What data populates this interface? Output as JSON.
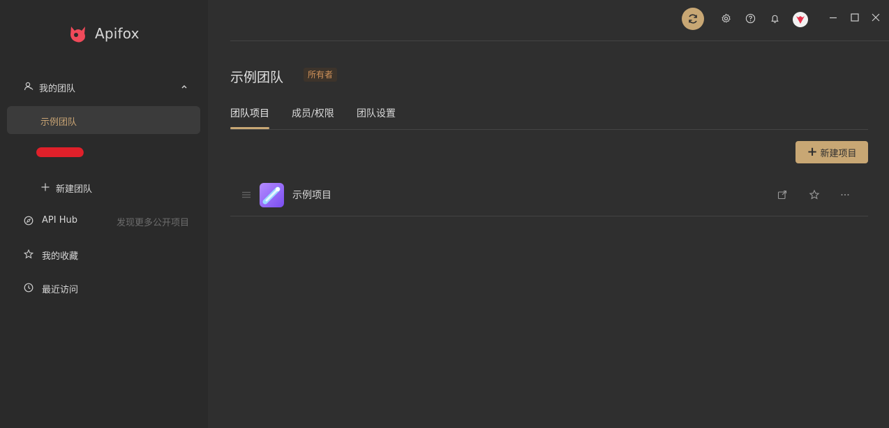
{
  "app": {
    "name": "Apifox"
  },
  "sidebar": {
    "my_team": "我的团队",
    "teams": [
      "示例团队"
    ],
    "new_team": "新建团队",
    "api_hub": "API Hub",
    "api_hub_hint": "发现更多公开项目",
    "favorites": "我的收藏",
    "recent": "最近访问"
  },
  "header": {
    "icons": [
      "sync-icon",
      "settings-icon",
      "help-icon",
      "bell-icon",
      "avatar",
      "minimize-icon",
      "maximize-icon",
      "close-icon"
    ]
  },
  "team": {
    "title": "示例团队",
    "role_badge": "所有者"
  },
  "tabs": [
    {
      "label": "团队项目",
      "active": true
    },
    {
      "label": "成员/权限",
      "active": false
    },
    {
      "label": "团队设置",
      "active": false
    }
  ],
  "actions": {
    "new_project": "新建项目"
  },
  "projects": [
    {
      "name": "示例项目"
    }
  ],
  "colors": {
    "accent": "#c8a774",
    "selected_text": "#c9a474",
    "badge_text": "#d0925a"
  }
}
